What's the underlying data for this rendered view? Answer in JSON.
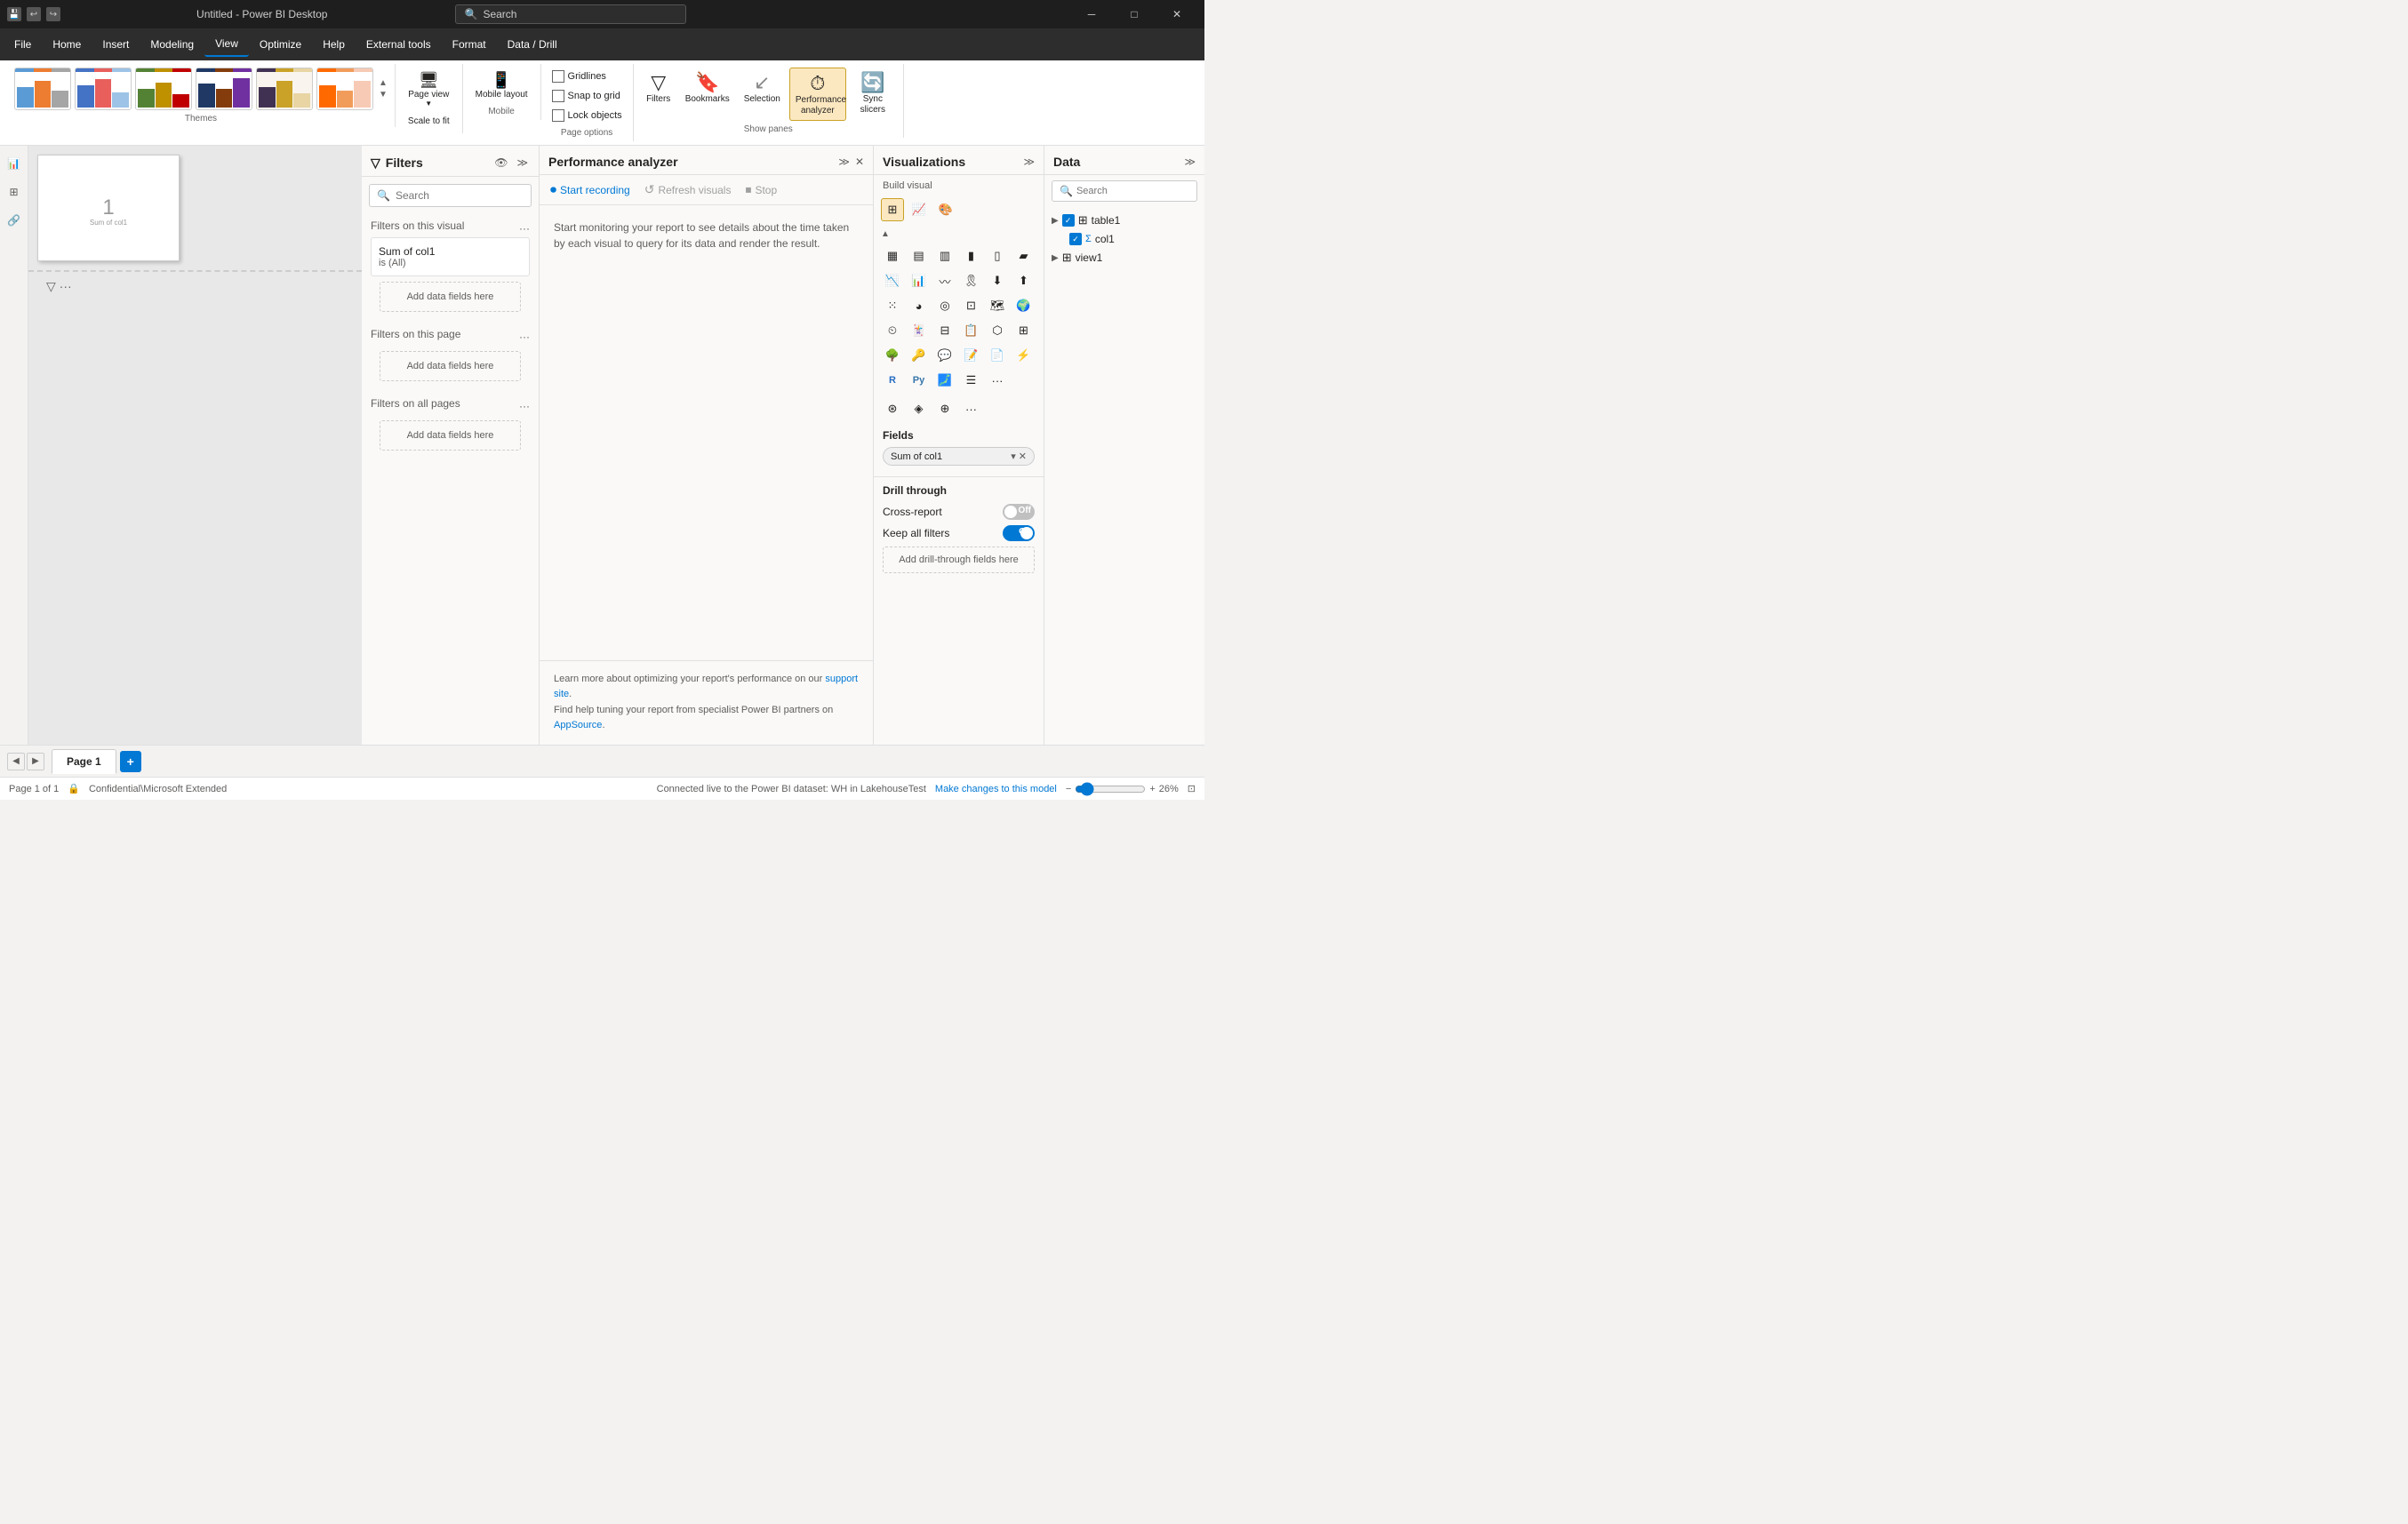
{
  "titlebar": {
    "title": "Untitled - Power BI Desktop",
    "search_placeholder": "Search",
    "minimize": "─",
    "maximize": "□",
    "close": "✕"
  },
  "menubar": {
    "items": [
      {
        "label": "File",
        "active": false
      },
      {
        "label": "Home",
        "active": false
      },
      {
        "label": "Insert",
        "active": false
      },
      {
        "label": "Modeling",
        "active": false
      },
      {
        "label": "View",
        "active": true
      },
      {
        "label": "Optimize",
        "active": false
      },
      {
        "label": "Help",
        "active": false
      },
      {
        "label": "External tools",
        "active": false
      },
      {
        "label": "Format",
        "active": false
      },
      {
        "label": "Data / Drill",
        "active": false
      }
    ]
  },
  "ribbon": {
    "themes_label": "Themes",
    "page_view_label": "Page view",
    "scale_label": "Scale to fit",
    "mobile_layout_label": "Mobile layout",
    "mobile_label": "Mobile",
    "gridlines_label": "Gridlines",
    "snap_to_grid_label": "Snap to grid",
    "lock_objects_label": "Lock objects",
    "page_options_label": "Page options",
    "filters_label": "Filters",
    "bookmarks_label": "Bookmarks",
    "selection_label": "Selection",
    "performance_label": "Performance analyzer",
    "sync_slicers_label": "Sync slicers",
    "show_panes_label": "Show panes"
  },
  "filters_panel": {
    "title": "Filters",
    "search_placeholder": "Search",
    "this_visual_label": "Filters on this visual",
    "this_page_label": "Filters on this page",
    "all_pages_label": "Filters on all pages",
    "add_fields_label": "Add data fields here",
    "filter_name": "Sum of col1",
    "filter_value": "is (All)"
  },
  "perf_panel": {
    "title": "Performance analyzer",
    "start_recording_label": "Start recording",
    "refresh_visuals_label": "Refresh visuals",
    "stop_label": "Stop",
    "description": "Start monitoring your report to see details about the time taken by each visual to query for its data and render the result.",
    "footer_text1": "Learn more about optimizing your report's performance on our ",
    "footer_link1": "support site",
    "footer_text2": ".",
    "footer_text3": "Find help tuning your report from specialist Power BI partners on ",
    "footer_link2": "AppSource",
    "footer_text4": "."
  },
  "viz_panel": {
    "title": "Visualizations",
    "build_visual_label": "Build visual",
    "fields_label": "Fields",
    "field_value": "Sum of col1",
    "drill_label": "Drill through",
    "cross_report_label": "Cross-report",
    "keep_filters_label": "Keep all filters",
    "cross_report_state": "off",
    "keep_filters_state": "on",
    "add_drill_label": "Add drill-through fields here"
  },
  "data_panel": {
    "title": "Data",
    "search_placeholder": "Search",
    "table1_label": "table1",
    "col1_label": "col1",
    "view1_label": "view1"
  },
  "page_tabs": {
    "page1_label": "Page 1",
    "add_label": "+"
  },
  "statusbar": {
    "page_info": "Page 1 of 1",
    "confidential": "Confidential\\Microsoft Extended",
    "connection": "Connected live to the Power BI dataset: WH in LakehouseTest",
    "change_model": "Make changes to this model",
    "zoom": "26%"
  }
}
